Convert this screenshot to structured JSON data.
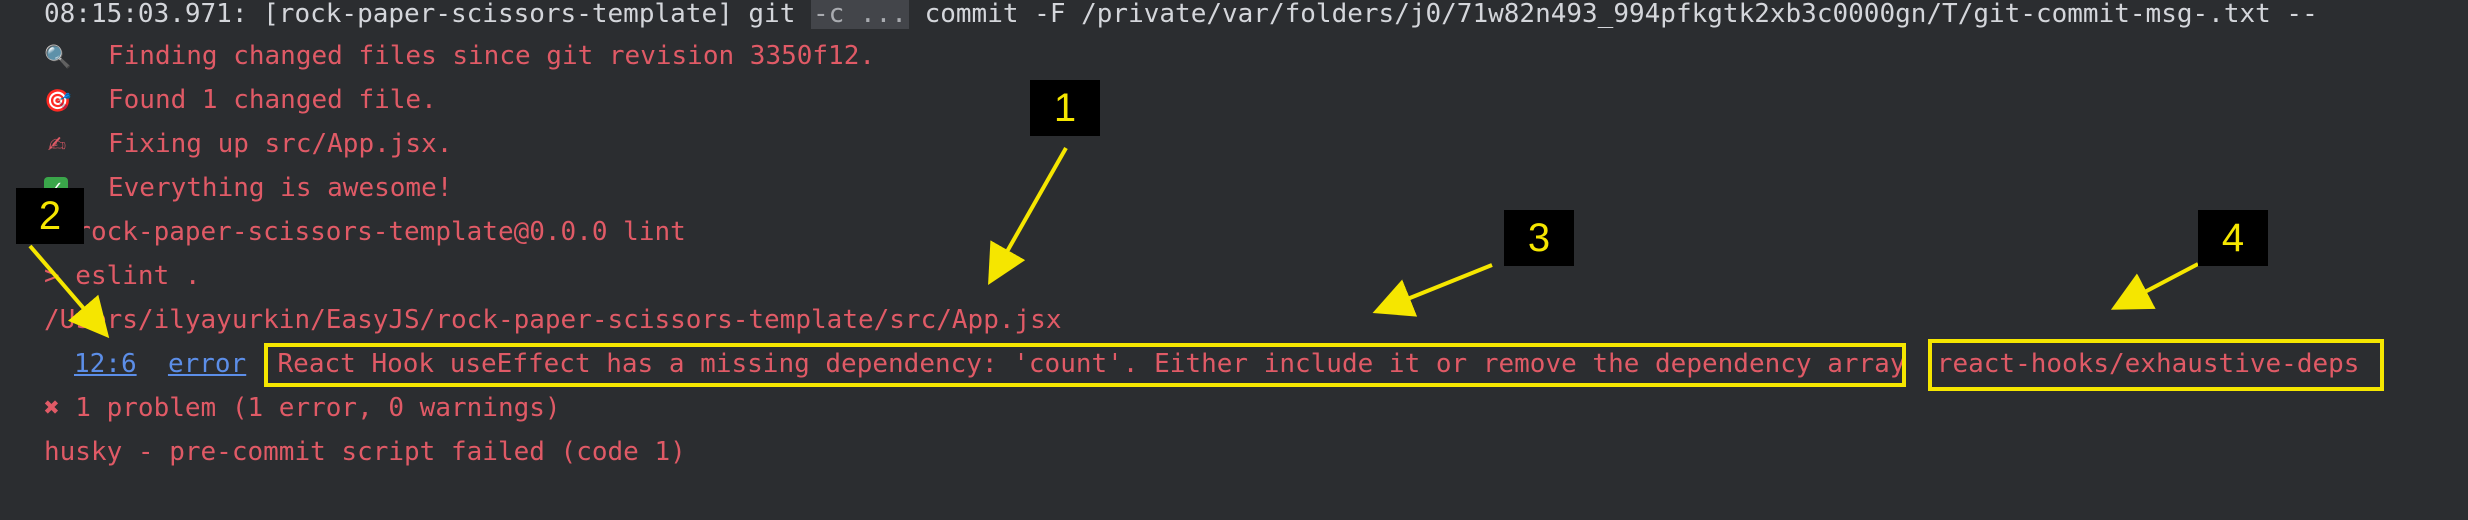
{
  "terminal": {
    "line1": {
      "prefix": "08:15:03.971: [rock-paper-scissors-template] git ",
      "flag": "-c ...",
      "suffix": " commit -F /private/var/folders/j0/71w82n493_994pfkgtk2xb3c0000gn/T/git-commit-msg-.txt --"
    },
    "line2": {
      "icon": "magnifier-icon",
      "glyph": "🔍",
      "text": "Finding changed files since git revision 3350f12."
    },
    "line3": {
      "icon": "target-icon",
      "glyph": "🎯",
      "text": "Found 1 changed file."
    },
    "line4": {
      "icon": "writing-hand-icon",
      "glyph": "✍",
      "text": "Fixing up src/App.jsx."
    },
    "line5": {
      "icon": "check-mark-icon",
      "glyph": "✓",
      "text": "Everything is awesome!"
    },
    "line6": "> rock-paper-scissors-template@0.0.0 lint",
    "line7": "> eslint .",
    "line8": "/Users/ilyayurkin/EasyJS/rock-paper-scissors-template/src/App.jsx",
    "line9": {
      "location": "12:6",
      "severity": "error",
      "message": "React Hook useEffect has a missing dependency: 'count'. Either include it or remove the dependency array",
      "rule": "react-hooks/exhaustive-deps"
    },
    "line10": "✖ 1 problem (1 error, 0 warnings)",
    "line11": "husky - pre-commit script failed (code 1)"
  },
  "annotations": {
    "label1": "1",
    "label2": "2",
    "label3": "3",
    "label4": "4",
    "color": "#f5e600"
  }
}
